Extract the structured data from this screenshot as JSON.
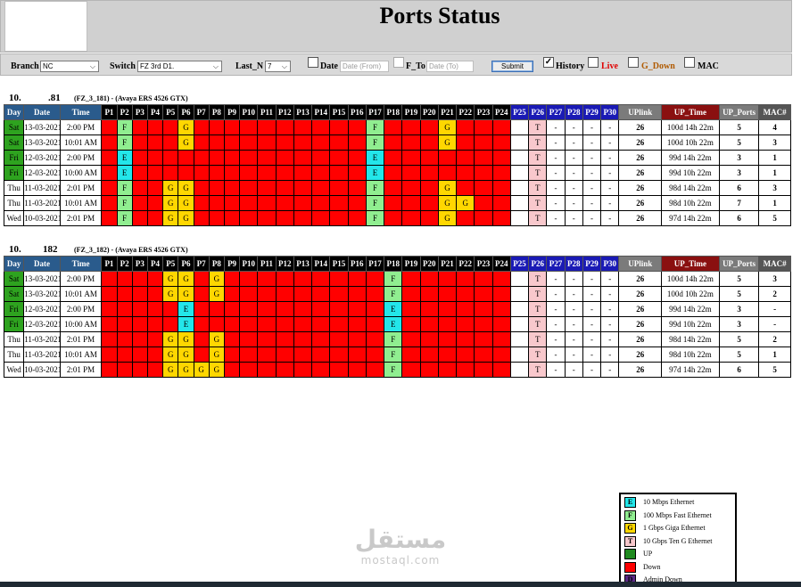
{
  "title": "Ports Status",
  "filters": {
    "branch_label": "Branch",
    "branch_value": "NC",
    "switch_label": "Switch",
    "switch_value": "FZ 3rd D1.",
    "lastn_label": "Last_N",
    "lastn_value": "7",
    "date_label": "Date",
    "date_from_placeholder": "Date (From)",
    "fto_label": "F_To",
    "date_to_placeholder": "Date (To)",
    "submit_label": "Submit",
    "history_label": "History",
    "live_label": "Live",
    "gdown_label": "G_Down",
    "mac_label": "MAC",
    "history_checked": true,
    "live_checked": false,
    "gdown_checked": false,
    "mac_checked": false,
    "date_checked": false
  },
  "headers": {
    "day": "Day",
    "date": "Date",
    "time": "Time",
    "ports": [
      "P1",
      "P2",
      "P3",
      "P4",
      "P5",
      "P6",
      "P7",
      "P8",
      "P9",
      "P10",
      "P11",
      "P12",
      "P13",
      "P14",
      "P15",
      "P16",
      "P17",
      "P18",
      "P19",
      "P20",
      "P21",
      "P22",
      "P23",
      "P24",
      "P25",
      "P26",
      "P27",
      "P28",
      "P29",
      "P30"
    ],
    "uplink": "UPlink",
    "uptime": "UP_Time",
    "upports": "UP_Ports",
    "mac": "MAC#"
  },
  "switches": [
    {
      "ip_a": "10.",
      "ip_b": ".81",
      "desc": "(FZ_3_181) - (Avaya ERS 4526 GTX)",
      "rows": [
        {
          "day": "Sat",
          "date": "13-03-2021",
          "time": "2:00 PM",
          "ports": [
            "",
            "F",
            "",
            "",
            "",
            "G",
            "",
            "",
            "",
            "",
            "",
            "",
            "",
            "",
            "",
            "",
            "F",
            "",
            "",
            "",
            "G",
            "",
            "",
            "",
            "e",
            "T",
            "-",
            "-",
            "-",
            "-"
          ],
          "uplink": "26",
          "uptime": "100d 14h 22m",
          "upports": "5",
          "mac": "4"
        },
        {
          "day": "Sat",
          "date": "13-03-2021",
          "time": "10:01 AM",
          "ports": [
            "",
            "F",
            "",
            "",
            "",
            "G",
            "",
            "",
            "",
            "",
            "",
            "",
            "",
            "",
            "",
            "",
            "F",
            "",
            "",
            "",
            "G",
            "",
            "",
            "",
            "e",
            "T",
            "-",
            "-",
            "-",
            "-"
          ],
          "uplink": "26",
          "uptime": "100d 10h 22m",
          "upports": "5",
          "mac": "3"
        },
        {
          "day": "Fri",
          "date": "12-03-2021",
          "time": "2:00 PM",
          "ports": [
            "",
            "E",
            "",
            "",
            "",
            "",
            "",
            "",
            "",
            "",
            "",
            "",
            "",
            "",
            "",
            "",
            "E",
            "",
            "",
            "",
            "",
            "",
            "",
            "",
            "e",
            "T",
            "-",
            "-",
            "-",
            "-"
          ],
          "uplink": "26",
          "uptime": "99d 14h 22m",
          "upports": "3",
          "mac": "1"
        },
        {
          "day": "Fri",
          "date": "12-03-2021",
          "time": "10:00 AM",
          "ports": [
            "",
            "E",
            "",
            "",
            "",
            "",
            "",
            "",
            "",
            "",
            "",
            "",
            "",
            "",
            "",
            "",
            "E",
            "",
            "",
            "",
            "",
            "",
            "",
            "",
            "e",
            "T",
            "-",
            "-",
            "-",
            "-"
          ],
          "uplink": "26",
          "uptime": "99d 10h 22m",
          "upports": "3",
          "mac": "1"
        },
        {
          "day": "Thu",
          "date": "11-03-2021",
          "time": "2:01 PM",
          "ports": [
            "",
            "F",
            "",
            "",
            "G",
            "G",
            "",
            "",
            "",
            "",
            "",
            "",
            "",
            "",
            "",
            "",
            "F",
            "",
            "",
            "",
            "G",
            "",
            "",
            "",
            "e",
            "T",
            "-",
            "-",
            "-",
            "-"
          ],
          "uplink": "26",
          "uptime": "98d 14h 22m",
          "upports": "6",
          "mac": "3"
        },
        {
          "day": "Thu",
          "date": "11-03-2021",
          "time": "10:01 AM",
          "ports": [
            "",
            "F",
            "",
            "",
            "G",
            "G",
            "",
            "",
            "",
            "",
            "",
            "",
            "",
            "",
            "",
            "",
            "F",
            "",
            "",
            "",
            "G",
            "G",
            "",
            "",
            "e",
            "T",
            "-",
            "-",
            "-",
            "-"
          ],
          "uplink": "26",
          "uptime": "98d 10h 22m",
          "upports": "7",
          "mac": "1"
        },
        {
          "day": "Wed",
          "date": "10-03-2021",
          "time": "2:01 PM",
          "ports": [
            "",
            "F",
            "",
            "",
            "G",
            "G",
            "",
            "",
            "",
            "",
            "",
            "",
            "",
            "",
            "",
            "",
            "F",
            "",
            "",
            "",
            "G",
            "",
            "",
            "",
            "e",
            "T",
            "-",
            "-",
            "-",
            "-"
          ],
          "uplink": "26",
          "uptime": "97d 14h 22m",
          "upports": "6",
          "mac": "5"
        }
      ]
    },
    {
      "ip_a": "10.",
      "ip_b": "182",
      "desc": "(FZ_3_182) - (Avaya ERS 4526 GTX)",
      "rows": [
        {
          "day": "Sat",
          "date": "13-03-2021",
          "time": "2:00 PM",
          "ports": [
            "",
            "",
            "",
            "",
            "G",
            "G",
            "",
            "G",
            "",
            "",
            "",
            "",
            "",
            "",
            "",
            "",
            "",
            "F",
            "",
            "",
            "",
            "",
            "",
            "",
            "e",
            "T",
            "-",
            "-",
            "-",
            "-"
          ],
          "uplink": "26",
          "uptime": "100d 14h 22m",
          "upports": "5",
          "mac": "3"
        },
        {
          "day": "Sat",
          "date": "13-03-2021",
          "time": "10:01 AM",
          "ports": [
            "",
            "",
            "",
            "",
            "G",
            "G",
            "",
            "G",
            "",
            "",
            "",
            "",
            "",
            "",
            "",
            "",
            "",
            "F",
            "",
            "",
            "",
            "",
            "",
            "",
            "e",
            "T",
            "-",
            "-",
            "-",
            "-"
          ],
          "uplink": "26",
          "uptime": "100d 10h 22m",
          "upports": "5",
          "mac": "2"
        },
        {
          "day": "Fri",
          "date": "12-03-2021",
          "time": "2:00 PM",
          "ports": [
            "",
            "",
            "",
            "",
            "",
            "E",
            "",
            "",
            "",
            "",
            "",
            "",
            "",
            "",
            "",
            "",
            "",
            "E",
            "",
            "",
            "",
            "",
            "",
            "",
            "e",
            "T",
            "-",
            "-",
            "-",
            "-"
          ],
          "uplink": "26",
          "uptime": "99d 14h 22m",
          "upports": "3",
          "mac": "-"
        },
        {
          "day": "Fri",
          "date": "12-03-2021",
          "time": "10:00 AM",
          "ports": [
            "",
            "",
            "",
            "",
            "",
            "E",
            "",
            "",
            "",
            "",
            "",
            "",
            "",
            "",
            "",
            "",
            "",
            "E",
            "",
            "",
            "",
            "",
            "",
            "",
            "e",
            "T",
            "-",
            "-",
            "-",
            "-"
          ],
          "uplink": "26",
          "uptime": "99d 10h 22m",
          "upports": "3",
          "mac": "-"
        },
        {
          "day": "Thu",
          "date": "11-03-2021",
          "time": "2:01 PM",
          "ports": [
            "",
            "",
            "",
            "",
            "G",
            "G",
            "",
            "G",
            "",
            "",
            "",
            "",
            "",
            "",
            "",
            "",
            "",
            "F",
            "",
            "",
            "",
            "",
            "",
            "",
            "e",
            "T",
            "-",
            "-",
            "-",
            "-"
          ],
          "uplink": "26",
          "uptime": "98d 14h 22m",
          "upports": "5",
          "mac": "2"
        },
        {
          "day": "Thu",
          "date": "11-03-2021",
          "time": "10:01 AM",
          "ports": [
            "",
            "",
            "",
            "",
            "G",
            "G",
            "",
            "G",
            "",
            "",
            "",
            "",
            "",
            "",
            "",
            "",
            "",
            "F",
            "",
            "",
            "",
            "",
            "",
            "",
            "e",
            "T",
            "-",
            "-",
            "-",
            "-"
          ],
          "uplink": "26",
          "uptime": "98d 10h 22m",
          "upports": "5",
          "mac": "1"
        },
        {
          "day": "Wed",
          "date": "10-03-2021",
          "time": "2:01 PM",
          "ports": [
            "",
            "",
            "",
            "",
            "G",
            "G",
            "G",
            "G",
            "",
            "",
            "",
            "",
            "",
            "",
            "",
            "",
            "",
            "F",
            "",
            "",
            "",
            "",
            "",
            "",
            "e",
            "T",
            "-",
            "-",
            "-",
            "-"
          ],
          "uplink": "26",
          "uptime": "97d 14h 22m",
          "upports": "6",
          "mac": "5"
        }
      ]
    }
  ],
  "legend": [
    {
      "code": "E",
      "label": "10 Mbps Ethernet",
      "color": "#23e6ea"
    },
    {
      "code": "F",
      "label": "100 Mbps Fast Ethernet",
      "color": "#90ee90"
    },
    {
      "code": "G",
      "label": "1 Gbps Giga Ethernet",
      "color": "#ffd700"
    },
    {
      "code": "T",
      "label": "10 Gbps Ten G Ethernet",
      "color": "#f8c8cc"
    },
    {
      "code": "",
      "label": "UP",
      "color": "#1f8a1f"
    },
    {
      "code": "",
      "label": "Down",
      "color": "#ff0000"
    },
    {
      "code": "D",
      "label": "Admin Down",
      "color": "#5b2a86"
    }
  ],
  "watermark": {
    "arabic": "مستقل",
    "latin": "mostaql.com"
  }
}
